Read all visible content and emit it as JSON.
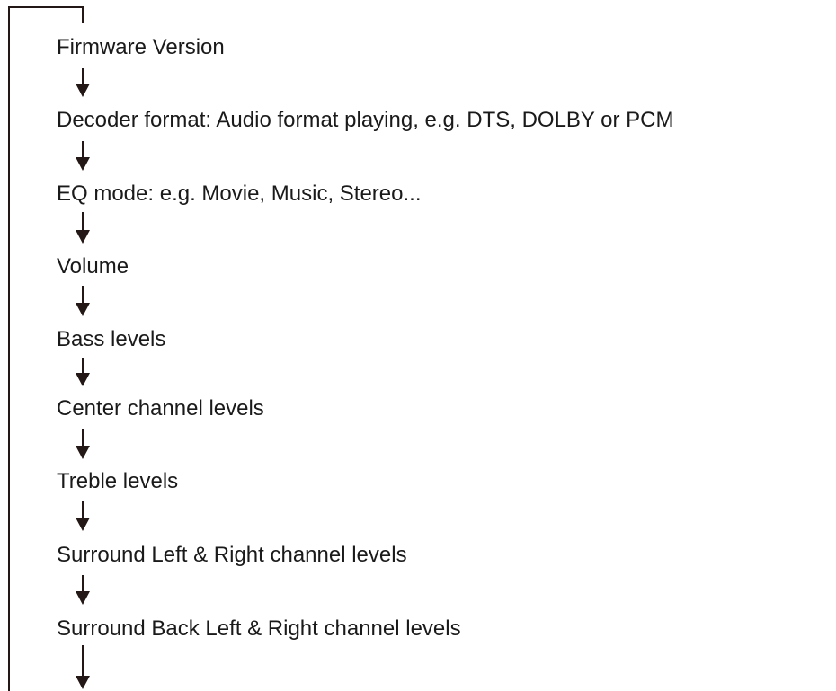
{
  "flow": {
    "steps": [
      "Firmware Version",
      "Decoder format: Audio format playing, e.g. DTS, DOLBY or PCM",
      "EQ mode: e.g. Movie, Music, Stereo...",
      "Volume",
      "Bass levels",
      "Center channel levels",
      "Treble levels",
      "Surround Left & Right channel levels",
      "Surround Back Left & Right channel levels"
    ],
    "line_color": "#231815"
  }
}
